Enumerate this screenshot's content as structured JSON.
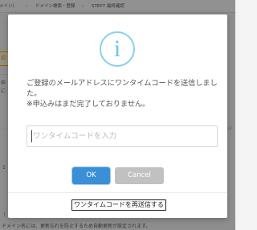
{
  "background": {
    "steps": [
      {
        "label": "メイン）"
      },
      {
        "label": "ドメイン検索・登録"
      },
      {
        "label": "STEP7 最終確認"
      }
    ],
    "step_arrow": "›",
    "left_tab_label": "認",
    "right_text": "ジ",
    "side_chars": [
      "申",
      "に",
      "1",
      "（"
    ],
    "footer_note": "ドメイン名には、更新忘れを防止するため自動更新が設定されます。"
  },
  "modal": {
    "icon": "info-icon",
    "icon_glyph": "i",
    "icon_color": "#89d0ec",
    "message_lines": [
      "ご登録のメールアドレスにワンタイムコードを送信しまし",
      "た。",
      "※申込みはまだ完了しておりません。"
    ],
    "code_input": {
      "placeholder": "ワンタイムコードを入力",
      "value": ""
    },
    "ok_label": "OK",
    "cancel_label": "Cancel",
    "resend_label": "ワンタイムコードを再送信する",
    "colors": {
      "ok": "#3a8fd6",
      "cancel": "#c1c1c1"
    }
  }
}
